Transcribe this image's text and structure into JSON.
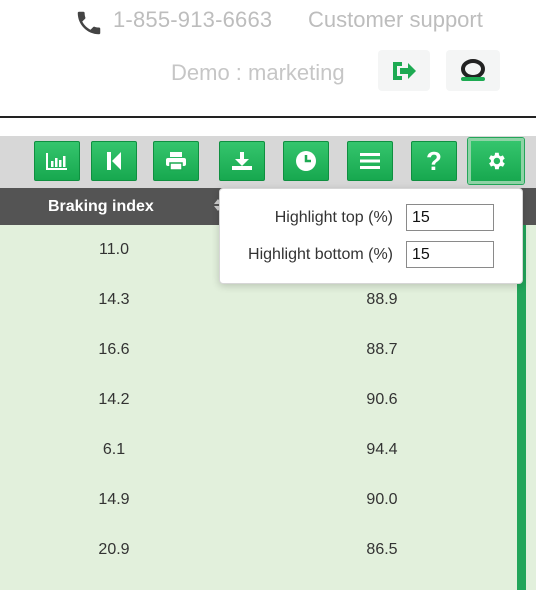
{
  "header": {
    "phone_icon": "phone-icon",
    "phone_number": "1-855-913-6663",
    "support_label": "Customer support",
    "demo_label": "Demo : marketing",
    "logout_icon": "logout-icon",
    "brand_logo": "brand-logo"
  },
  "toolbar": {
    "buttons": [
      {
        "icon": "chart-icon"
      },
      {
        "icon": "skip-back-icon"
      },
      {
        "icon": "print-icon"
      },
      {
        "icon": "download-icon"
      },
      {
        "icon": "clock-icon"
      },
      {
        "icon": "list-icon"
      },
      {
        "icon": "help-icon",
        "label": "?"
      },
      {
        "icon": "settings-icon",
        "active": true
      }
    ]
  },
  "table": {
    "column_1_header": "Braking index",
    "rows": [
      {
        "c1": "11.0",
        "c2": ""
      },
      {
        "c1": "14.3",
        "c2": "88.9"
      },
      {
        "c1": "16.6",
        "c2": "88.7"
      },
      {
        "c1": "14.2",
        "c2": "90.6"
      },
      {
        "c1": "6.1",
        "c2": "94.4"
      },
      {
        "c1": "14.9",
        "c2": "90.0"
      },
      {
        "c1": "20.9",
        "c2": "86.5"
      }
    ]
  },
  "settings_popup": {
    "highlight_top_label": "Highlight top (%)",
    "highlight_top_value": "15",
    "highlight_bottom_label": "Highlight bottom (%)",
    "highlight_bottom_value": "15"
  },
  "colors": {
    "accent": "#22a55a",
    "row_bg": "#e2f0dc",
    "header_bg": "#545454",
    "toolbar_bg": "#d7d7d7"
  }
}
